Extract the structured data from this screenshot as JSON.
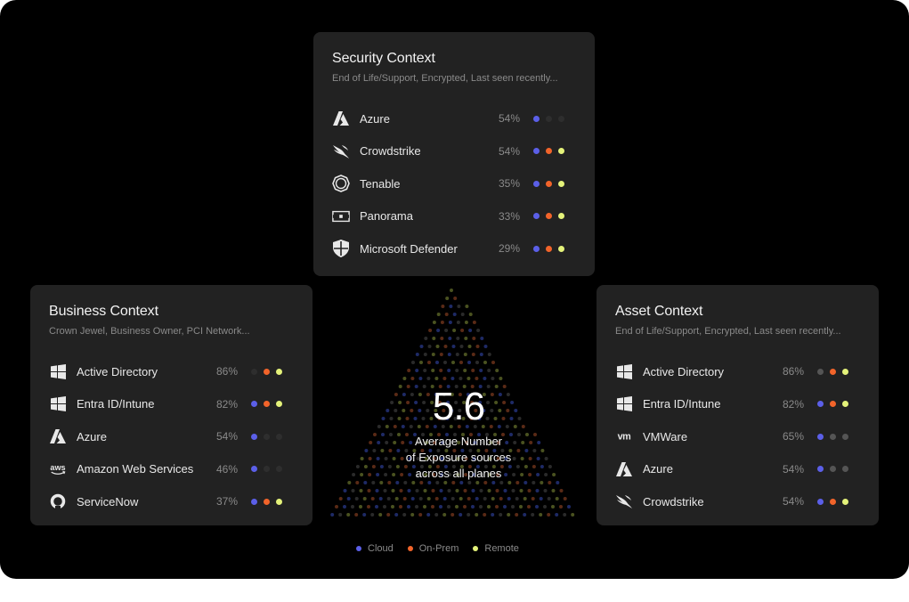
{
  "colors": {
    "cloud": "#5b5fe8",
    "on_prem": "#f2642a",
    "remote": "#e4f27a",
    "off": "#3a3a3a"
  },
  "center": {
    "value": "5.6",
    "label_line1": "Average Number",
    "label_line2": "of Exposure sources",
    "label_line3": "across all planes"
  },
  "legend": [
    {
      "label": "Cloud",
      "color": "#5b5fe8"
    },
    {
      "label": "On-Prem",
      "color": "#f2642a"
    },
    {
      "label": "Remote",
      "color": "#e4f27a"
    }
  ],
  "security": {
    "title": "Security Context",
    "subtitle": "End of Life/Support, Encrypted, Last seen recently...",
    "items": [
      {
        "name": "Azure",
        "pct": "54%",
        "icon": "azure-icon",
        "dots": [
          "cloud",
          "off",
          "off"
        ]
      },
      {
        "name": "Crowdstrike",
        "pct": "54%",
        "icon": "crowdstrike-icon",
        "dots": [
          "cloud",
          "on_prem",
          "remote"
        ]
      },
      {
        "name": "Tenable",
        "pct": "35%",
        "icon": "tenable-icon",
        "dots": [
          "cloud",
          "on_prem",
          "remote"
        ]
      },
      {
        "name": "Panorama",
        "pct": "33%",
        "icon": "panorama-icon",
        "dots": [
          "cloud",
          "on_prem",
          "remote"
        ]
      },
      {
        "name": "Microsoft Defender",
        "pct": "29%",
        "icon": "shield-icon",
        "dots": [
          "cloud",
          "on_prem",
          "remote"
        ]
      }
    ]
  },
  "business": {
    "title": "Business Context",
    "subtitle": "Crown Jewel, Business Owner, PCI Network...",
    "items": [
      {
        "name": "Active Directory",
        "pct": "86%",
        "icon": "windows-icon",
        "dots": [
          "off",
          "on_prem",
          "remote"
        ]
      },
      {
        "name": "Entra ID/Intune",
        "pct": "82%",
        "icon": "windows-icon",
        "dots": [
          "cloud",
          "on_prem",
          "remote"
        ]
      },
      {
        "name": "Azure",
        "pct": "54%",
        "icon": "azure-icon",
        "dots": [
          "cloud",
          "off",
          "off"
        ]
      },
      {
        "name": "Amazon Web Services",
        "pct": "46%",
        "icon": "aws-icon",
        "dots": [
          "cloud",
          "off",
          "off"
        ]
      },
      {
        "name": "ServiceNow",
        "pct": "37%",
        "icon": "servicenow-icon",
        "dots": [
          "cloud",
          "on_prem",
          "remote"
        ]
      }
    ]
  },
  "asset": {
    "title": "Asset Context",
    "subtitle": "End of Life/Support, Encrypted, Last seen recently...",
    "items": [
      {
        "name": "Active Directory",
        "pct": "86%",
        "icon": "windows-icon",
        "dots": [
          "off_light",
          "on_prem",
          "remote"
        ]
      },
      {
        "name": "Entra ID/Intune",
        "pct": "82%",
        "icon": "windows-icon",
        "dots": [
          "cloud",
          "on_prem",
          "remote"
        ]
      },
      {
        "name": "VMWare",
        "pct": "65%",
        "icon": "vmware-icon",
        "dots": [
          "cloud",
          "off_light",
          "off_light"
        ]
      },
      {
        "name": "Azure",
        "pct": "54%",
        "icon": "azure-icon",
        "dots": [
          "cloud",
          "off_light",
          "off_light"
        ]
      },
      {
        "name": "Crowdstrike",
        "pct": "54%",
        "icon": "crowdstrike-icon",
        "dots": [
          "cloud",
          "on_prem",
          "remote"
        ]
      }
    ]
  }
}
